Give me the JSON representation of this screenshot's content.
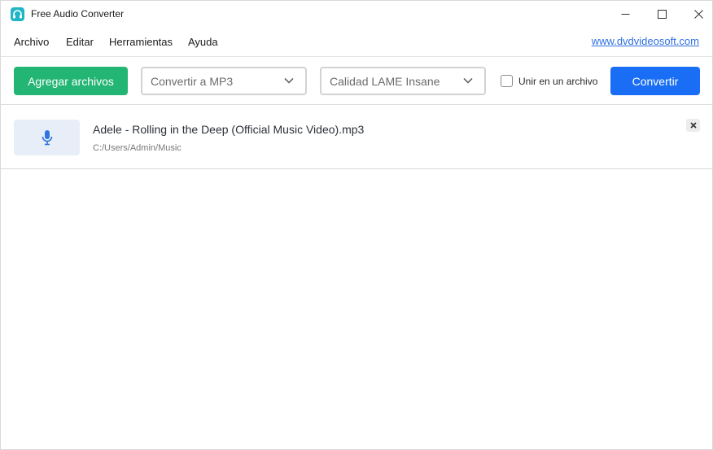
{
  "window": {
    "title": "Free Audio Converter",
    "icons": {
      "app": "headphones-icon",
      "minimize": "minimize-icon",
      "maximize": "maximize-icon",
      "close": "close-icon"
    }
  },
  "menu": {
    "items": [
      "Archivo",
      "Editar",
      "Herramientas",
      "Ayuda"
    ],
    "link": "www.dvdvideosoft.com"
  },
  "toolbar": {
    "add_label": "Agregar archivos",
    "format_value": "Convertir a MP3",
    "quality_value": "Calidad LAME Insane",
    "merge_label": "Unir en un archivo",
    "merge_checked": false,
    "convert_label": "Convertir"
  },
  "files": [
    {
      "name": "Adele - Rolling in the Deep (Official Music Video).mp3",
      "path": "C:/Users/Admin/Music",
      "icon": "microphone-icon"
    }
  ],
  "colors": {
    "add_button": "#22b574",
    "convert_button": "#1a6ef5",
    "link": "#2f6fe0",
    "app_icon": "#1fb5c6"
  }
}
